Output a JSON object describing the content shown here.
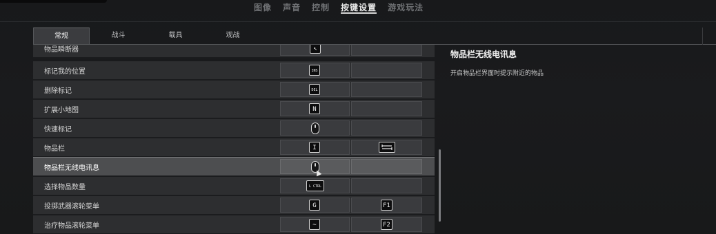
{
  "top_nav": {
    "tabs": [
      {
        "label": "图像",
        "active": false
      },
      {
        "label": "声音",
        "active": false
      },
      {
        "label": "控制",
        "active": false
      },
      {
        "label": "按键设置",
        "active": true
      },
      {
        "label": "游戏玩法",
        "active": false
      }
    ]
  },
  "sub_tabs": [
    {
      "label": "常规",
      "active": true
    },
    {
      "label": "战斗",
      "active": false
    },
    {
      "label": "载具",
      "active": false
    },
    {
      "label": "观战",
      "active": false
    }
  ],
  "bindings": [
    {
      "label": "物品瞬断器",
      "key1": "↖",
      "key2": ""
    },
    {
      "label": "标记我的位置",
      "key1": "INS",
      "key2": ""
    },
    {
      "label": "删除标记",
      "key1": "DEL",
      "key2": ""
    },
    {
      "label": "扩展小地图",
      "key1": "N",
      "key2": ""
    },
    {
      "label": "快速标记",
      "key1": "mouse-middle",
      "key2": ""
    },
    {
      "label": "物品栏",
      "key1": "I",
      "key2": "TAB"
    },
    {
      "label": "物品栏无线电讯息",
      "key1": "mouse-middle",
      "key2": "",
      "selected": true
    },
    {
      "label": "选择物品数量",
      "key1": "L CTRL",
      "key2": ""
    },
    {
      "label": "投掷武器滚轮菜单",
      "key1": "G",
      "key2": "F1"
    },
    {
      "label": "治疗物品滚轮菜单",
      "key1": "~",
      "key2": "F2"
    }
  ],
  "detail": {
    "title": "物品栏无线电讯息",
    "description": "开启物品栏界面时提示附近的物品"
  },
  "icons": {
    "mouse": "mouse-middle-icon",
    "tab_key": "tab-key-icon",
    "cursor": "cursor-arrow-icon"
  }
}
